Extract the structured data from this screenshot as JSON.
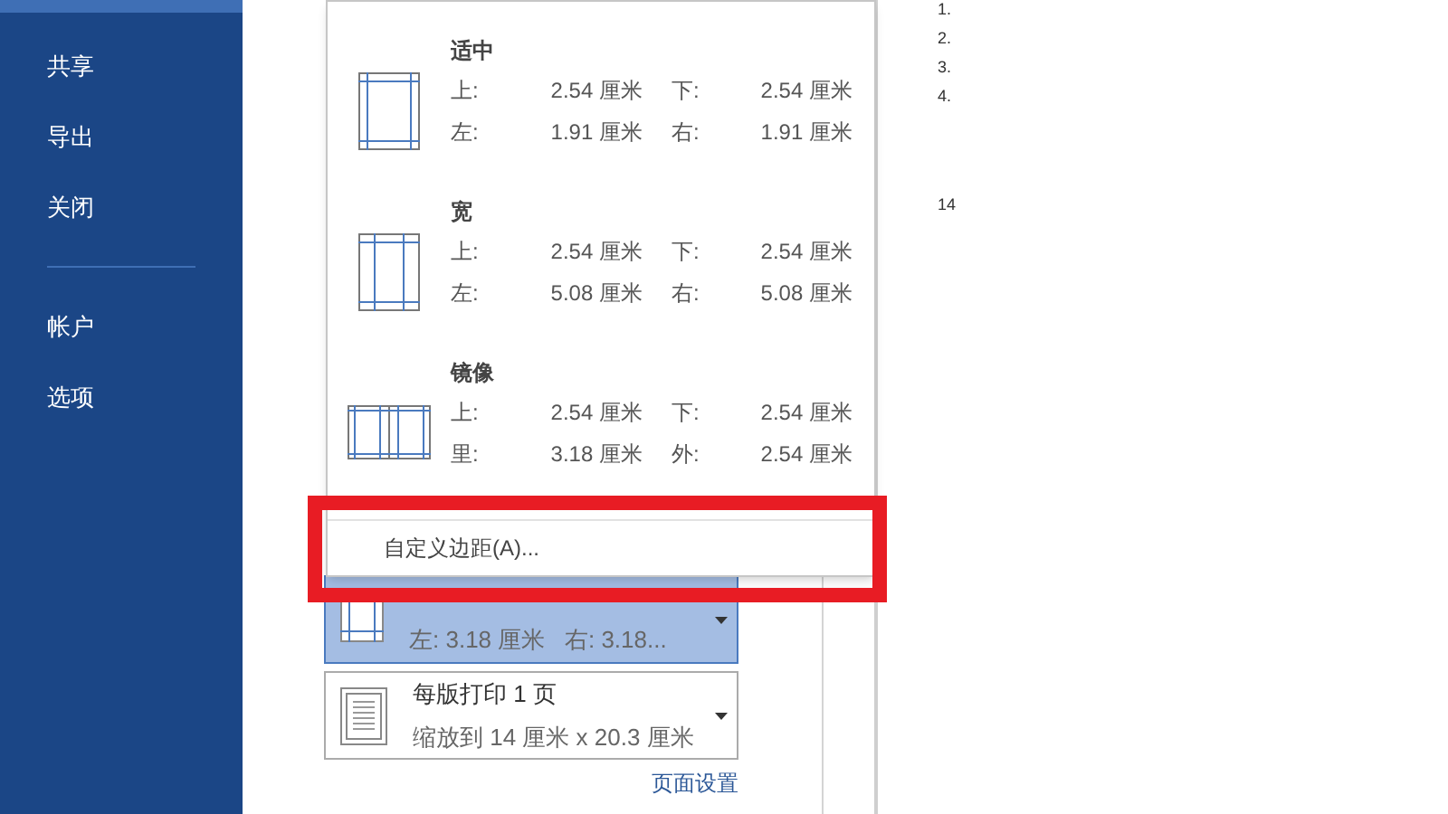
{
  "sidebar": {
    "items": [
      {
        "label": "共享"
      },
      {
        "label": "导出"
      },
      {
        "label": "关闭"
      },
      {
        "label": "帐户",
        "divider_before": true
      },
      {
        "label": "选项"
      }
    ]
  },
  "margin_menu": {
    "presets": [
      {
        "name": "适中",
        "kind": "normal",
        "fields": [
          {
            "label": "上:",
            "value": "2.54 厘米"
          },
          {
            "label": "下:",
            "value": "2.54 厘米"
          },
          {
            "label": "左:",
            "value": "1.91 厘米"
          },
          {
            "label": "右:",
            "value": "1.91 厘米"
          }
        ]
      },
      {
        "name": "宽",
        "kind": "wide",
        "fields": [
          {
            "label": "上:",
            "value": "2.54 厘米"
          },
          {
            "label": "下:",
            "value": "2.54 厘米"
          },
          {
            "label": "左:",
            "value": "5.08 厘米"
          },
          {
            "label": "右:",
            "value": "5.08 厘米"
          }
        ]
      },
      {
        "name": "镜像",
        "kind": "mirrored",
        "fields": [
          {
            "label": "上:",
            "value": "2.54 厘米"
          },
          {
            "label": "下:",
            "value": "2.54 厘米"
          },
          {
            "label": "里:",
            "value": "3.18 厘米"
          },
          {
            "label": "外:",
            "value": "2.54 厘米"
          }
        ]
      }
    ],
    "custom_item": "自定义边距(A)..."
  },
  "settings": [
    {
      "kind": "margins",
      "selected": true,
      "subtitle": "左: 3.18 厘米   右: 3.18..."
    },
    {
      "kind": "pages",
      "selected": false,
      "title": "每版打印 1 页",
      "subtitle": "缩放到 14 厘米 x 20.3 厘米"
    }
  ],
  "page_setup_link": "页面设置",
  "preview": {
    "lines": [
      "1.",
      "2.",
      "3.",
      "4."
    ],
    "page_number": "14"
  }
}
